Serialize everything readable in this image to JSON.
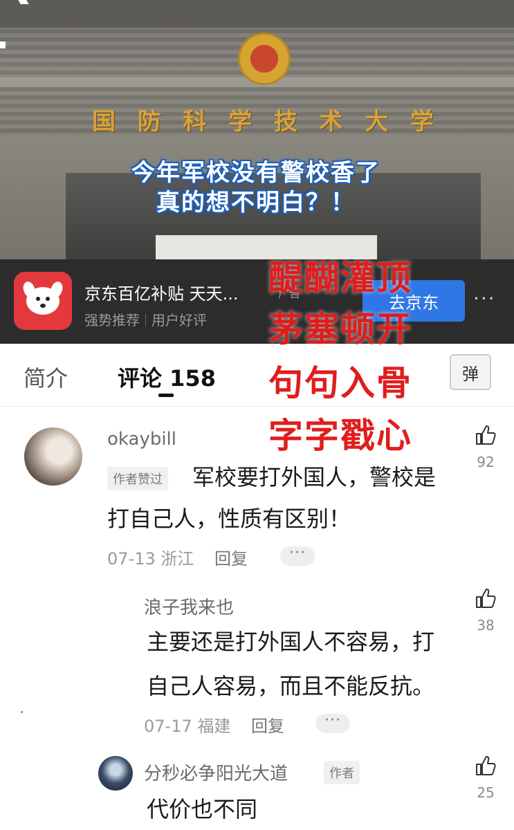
{
  "video": {
    "plaque_chars": [
      "国",
      "防",
      "科",
      "学",
      "技",
      "术",
      "大",
      "学"
    ],
    "caption_line1": "今年军校没有警校香了",
    "caption_line2": "真的想不明白？！"
  },
  "ad": {
    "title": "京东百亿补贴 天天...",
    "tag": "广告",
    "sub_left": "强势推荐",
    "sub_right": "用户好评",
    "button": "去京东",
    "more": "···"
  },
  "overlay": [
    "醍醐灌顶",
    "茅塞顿开",
    "句句入骨",
    "字字戳心"
  ],
  "tabs": {
    "intro": "简介",
    "comments_label": "评论",
    "comments_count": "158",
    "danmu": "弹"
  },
  "comments": [
    {
      "user": "okaybill",
      "badge": "作者赞过",
      "text_line1": "军校要打外国人，警校是",
      "text_line2": "打自己人，性质有区别！",
      "date": "07-13 浙江",
      "reply": "回复",
      "likes": "92"
    },
    {
      "user": "浪子我来也",
      "text_line1": "主要还是打外国人不容易，打",
      "text_line2": "自己人容易，而且不能反抗。",
      "date": "07-17 福建",
      "reply": "回复",
      "likes": "38"
    },
    {
      "user": "分秒必争阳光大道",
      "badge": "作者",
      "text_line1": "代价也不同",
      "likes": "25"
    }
  ],
  "more_label": "···",
  "colors": {
    "overlay_red": "#e01d1d",
    "ad_button": "#2f77e4",
    "jd_red": "#e4393c"
  }
}
